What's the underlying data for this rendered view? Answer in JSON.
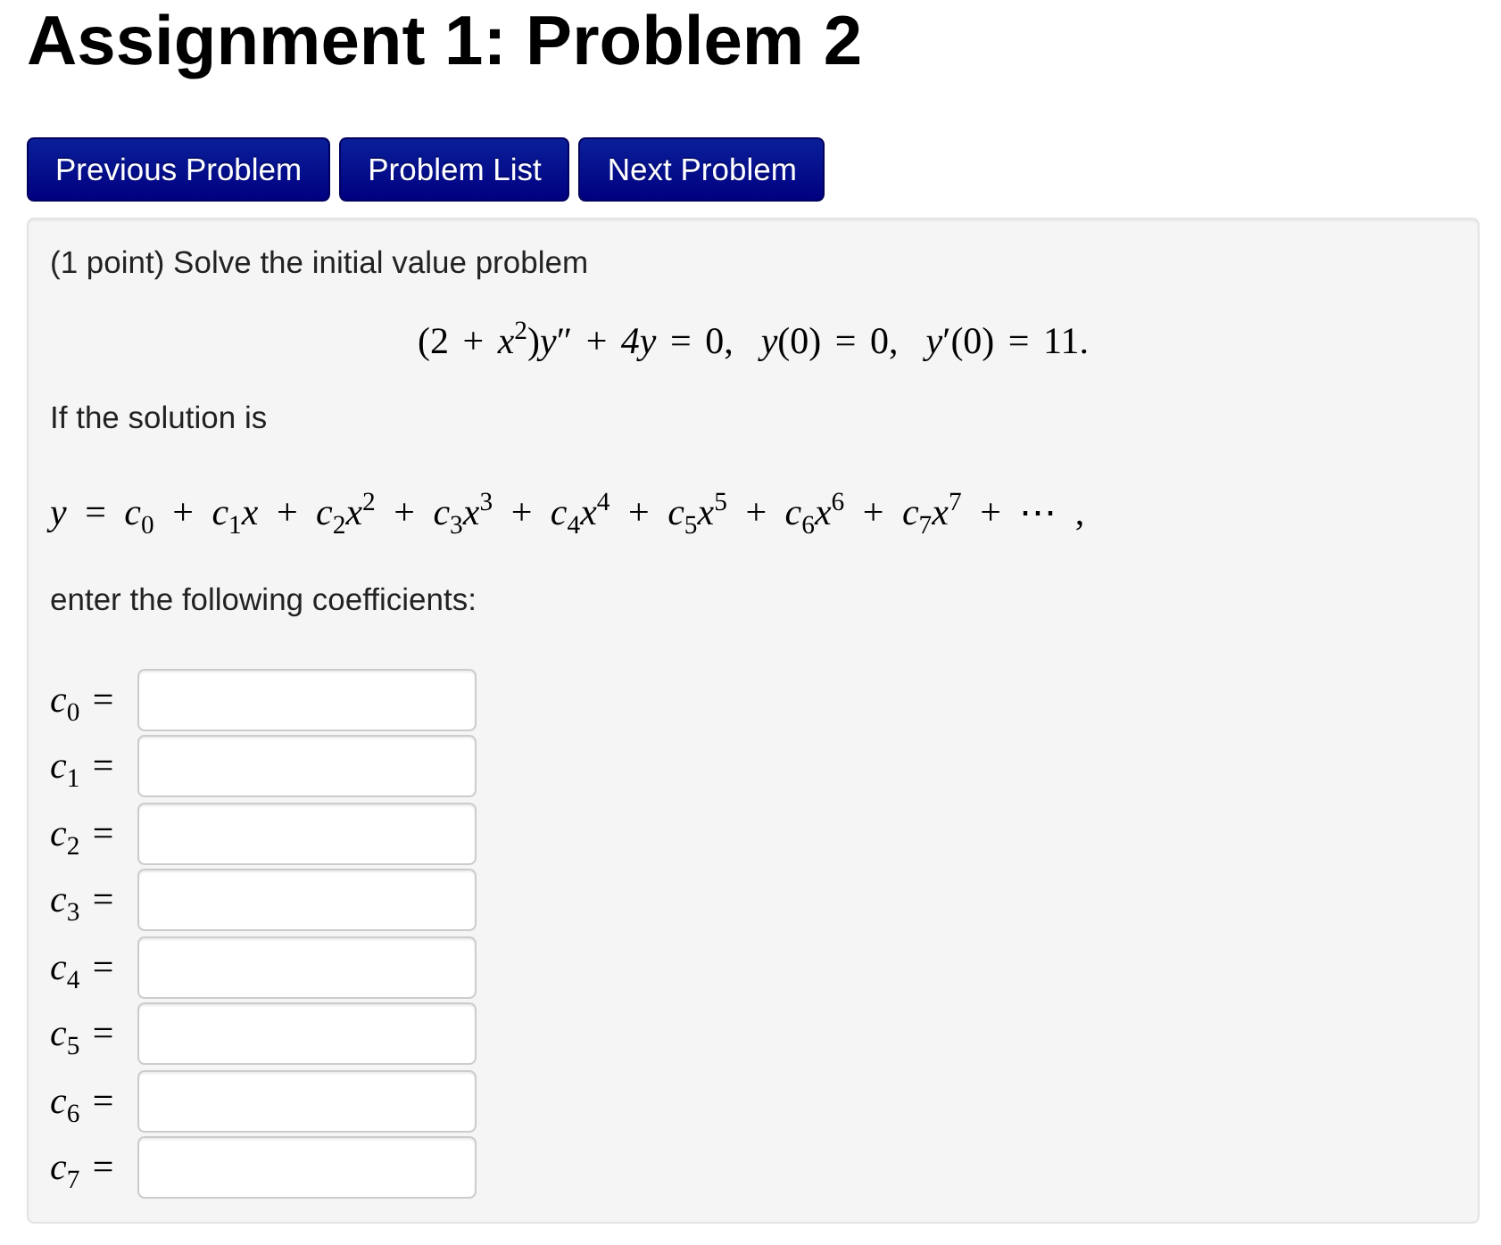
{
  "title": "Assignment 1: Problem 2",
  "buttons": [
    "Previous Problem",
    "Problem List",
    "Next Problem"
  ],
  "problem": {
    "intro": "(1 point) Solve the initial value problem",
    "equation": "(2 + *x*$^{2}$)*y*″ + *4y* = 0,  *y*(0) = 0,  *y*′(0) = 11.",
    "solution_intro": "If the solution is",
    "series": "*y* = *c*$_{0}$ + *c*$_{1}$*x* + *c*$_{2}$*x*$^{2}$ + *c*$_{3}$*x*$^{3}$ + *c*$_{4}$*x*$^{4}$ + *c*$_{5}$*x*$^{5}$ + *c*$_{6}$*x*$^{6}$ + *c*$_{7}$*x*$^{7}$ + ⋯ ,",
    "instruction": "enter the following coefficients:",
    "answers": [
      {
        "label": "*c*$_{0}$ ="
      },
      {
        "label": "*c*$_{1}$ ="
      },
      {
        "label": "*c*$_{2}$ ="
      },
      {
        "label": "*c*$_{3}$ ="
      },
      {
        "label": "*c*$_{4}$ ="
      },
      {
        "label": "*c*$_{5}$ ="
      },
      {
        "label": "*c*$_{6}$ ="
      },
      {
        "label": "*c*$_{7}$ ="
      }
    ]
  }
}
